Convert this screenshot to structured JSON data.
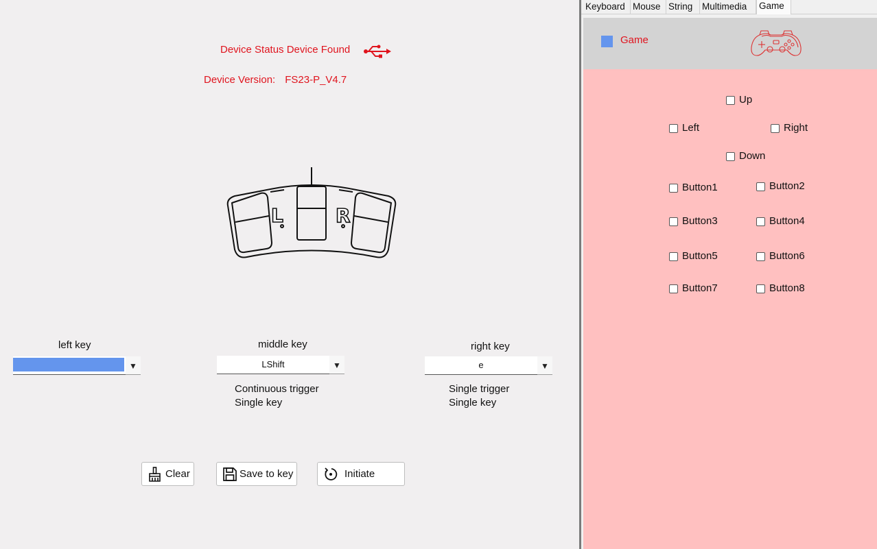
{
  "device": {
    "status_label": "Device Status",
    "status_value": "Device Found",
    "version_label": "Device Version:",
    "version_value": "FS23-P_V4.7"
  },
  "keys": {
    "left": {
      "label": "left key",
      "value": ""
    },
    "middle": {
      "label": "middle key",
      "value": "LShift",
      "trigger": "Continuous trigger",
      "mode": "Single key"
    },
    "right": {
      "label": "right key",
      "value": "e",
      "trigger": "Single trigger",
      "mode": "Single key"
    }
  },
  "pedal": {
    "left_letter": "L",
    "right_letter": "R"
  },
  "buttons": {
    "clear": "Clear",
    "save": "Save to key",
    "initiate": "Initiate"
  },
  "tabs": [
    "Keyboard",
    "Mouse",
    "String",
    "Multimedia",
    "Game"
  ],
  "active_tab": "Game",
  "game": {
    "title": "Game",
    "directions": {
      "up": "Up",
      "left": "Left",
      "right": "Right",
      "down": "Down"
    },
    "buttons": [
      "Button1",
      "Button2",
      "Button3",
      "Button4",
      "Button5",
      "Button6",
      "Button7",
      "Button8"
    ]
  },
  "colors": {
    "accent_red": "#e0141e",
    "selection_blue": "#6495ed",
    "game_panel": "#ffc0c0",
    "header_gray": "#d3d3d3"
  },
  "icons": {
    "usb": "usb-icon",
    "clear": "broom-icon",
    "save": "floppy-disk-icon",
    "initiate": "refresh-icon",
    "gamepad": "gamepad-icon",
    "dropdown": "triangle-down-icon"
  }
}
